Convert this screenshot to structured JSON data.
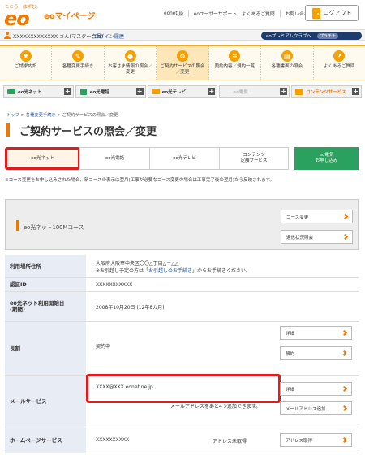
{
  "header": {
    "tagline": "こころ、はずむ。",
    "logo": "eo",
    "app_title": "eoマイページ",
    "links": [
      "eonet.jp",
      "eoユーザーサポート",
      "よくあるご質問",
      "お問い合わせ"
    ],
    "logout_label": "ログアウト"
  },
  "userbar": {
    "user_name": "XXXXXXXXXXXXX さん(マスター会員)",
    "login_history": "ログイン履歴",
    "premium_label": "eoプレミアムクラブへ",
    "premium_rank": "プラチナ"
  },
  "nav": [
    {
      "label": "ご請求内訳",
      "icon": "yen"
    },
    {
      "label": "各種変更手続き",
      "icon": "pen"
    },
    {
      "label": "お客さま情報の照会／変更",
      "icon": "person"
    },
    {
      "label": "ご契約サービスの照会／変更",
      "icon": "gear"
    },
    {
      "label": "契約内容／規約一覧",
      "icon": "doc"
    },
    {
      "label": "各種書面の照会",
      "icon": "book"
    },
    {
      "label": "よくあるご質問",
      "icon": "question"
    }
  ],
  "categories": [
    {
      "label": "eo光ネット"
    },
    {
      "label": "eo光電話"
    },
    {
      "label": "eo光テレビ"
    },
    {
      "label": "eo電気"
    },
    {
      "label": "コンテンツサービス"
    }
  ],
  "breadcrumb": {
    "home": "トップ",
    "parent": "各種変更手続き",
    "current": "ご契約サービスの照会／変更"
  },
  "page_title": "ご契約サービスの照会／変更",
  "service_tabs": {
    "net": "eo光ネット",
    "phone": "eo光電話",
    "tv": "eo光テレビ",
    "contents": "コンテンツ\n定額サービス",
    "denki": "eo電気\nお申し込み"
  },
  "notice": "※コース変更をお申し込みされた場合、新コースの表示は翌月(工事が必要なコース変更の場合は工事完了後の翌月)から反映されます。",
  "course": {
    "name": "eo光ネット100Mコース",
    "change_btn": "コース変更",
    "comm_btn": "通信状況照会"
  },
  "table": {
    "address_label": "利用場所住所",
    "address_value": "大阪府大阪市中央区〇〇△丁目△－△△",
    "move_note_prefix": "※お引越し予定の方は「",
    "move_note_link": "お引越しのお手続き",
    "move_note_suffix": "」からお手続きください。",
    "auth_label": "認証ID",
    "auth_value": "XXXXXXXXXXX",
    "start_label": "eo光ネット利用開始日\n(期間)",
    "start_value": "2008年10月20日 (12年8カ月)",
    "long_label": "長割",
    "long_value": "契約中",
    "detail_btn": "詳細",
    "cancel_btn": "解約",
    "mail_label": "メールサービス",
    "mail_value": "XXXX@XXX.eonet.ne.jp",
    "mail_detail_btn": "詳細",
    "mail_remaining": "メールアドレスをあと4つ追加できます。",
    "mail_add_btn": "メールアドレス追加",
    "hp_label": "ホームページサービス",
    "hp_value": "XXXXXXXXXX",
    "hp_status": "アドレス未取得",
    "hp_btn": "アドレス取得"
  }
}
